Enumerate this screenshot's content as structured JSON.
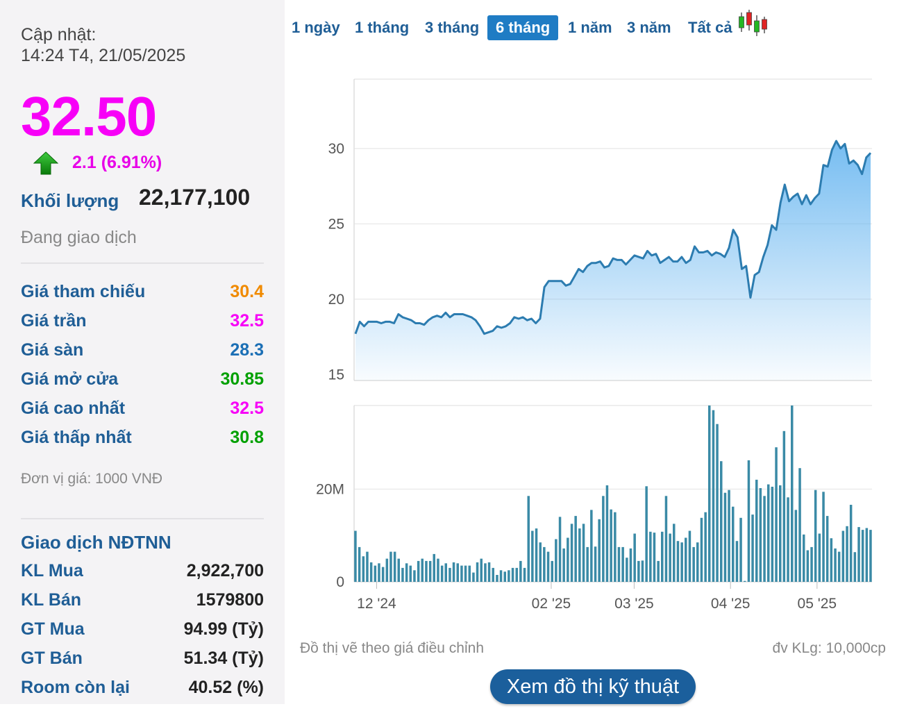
{
  "quote": {
    "update_label": "Cập nhật:",
    "update_time": "14:24 T4, 21/05/2025",
    "price": "32.50",
    "change": "2.1 (6.91%)",
    "volume_label": "Khối lượng",
    "volume_value": "22,177,100",
    "status": "Đang giao dịch"
  },
  "price_rows": [
    {
      "label": "Giá tham chiếu",
      "value": "30.4",
      "color": "#f08a00"
    },
    {
      "label": "Giá trần",
      "value": "32.5",
      "color": "#f700f7"
    },
    {
      "label": "Giá sàn",
      "value": "28.3",
      "color": "#1b6fb5"
    },
    {
      "label": "Giá mở cửa",
      "value": "30.85",
      "color": "#00a000"
    },
    {
      "label": "Giá cao nhất",
      "value": "32.5",
      "color": "#f700f7"
    },
    {
      "label": "Giá thấp nhất",
      "value": "30.8",
      "color": "#00a000"
    }
  ],
  "unit_note": "Đơn vị giá: 1000 VNĐ",
  "foreign": {
    "title": "Giao dịch NĐTNN",
    "rows": [
      {
        "label": "KL Mua",
        "value": "2,922,700"
      },
      {
        "label": "KL Bán",
        "value": "1579800"
      },
      {
        "label": "GT Mua",
        "value": "94.99 (Tỷ)"
      },
      {
        "label": "GT Bán",
        "value": "51.34 (Tỷ)"
      },
      {
        "label": "Room còn lại",
        "value": "40.52 (%)"
      }
    ]
  },
  "tabs": [
    {
      "label": "1 ngày",
      "active": false
    },
    {
      "label": "1 tháng",
      "active": false
    },
    {
      "label": "3 tháng",
      "active": false
    },
    {
      "label": "6 tháng",
      "active": true
    },
    {
      "label": "1 năm",
      "active": false
    },
    {
      "label": "3 năm",
      "active": false
    },
    {
      "label": "Tất cả",
      "active": false
    }
  ],
  "candle_icon": "candlestick-chart-icon",
  "chart_data": [
    {
      "type": "area",
      "yticks": [
        15,
        20,
        25,
        30
      ],
      "ylim": [
        14.6,
        34.6
      ],
      "x_ticks": [
        "12 '24",
        "02 '25",
        "03 '25",
        "04 '25",
        "05 '25"
      ],
      "values": [
        17.7,
        18.5,
        18.2,
        18.5,
        18.5,
        18.5,
        18.4,
        18.5,
        18.5,
        18.4,
        19.0,
        18.8,
        18.7,
        18.6,
        18.4,
        18.4,
        18.3,
        18.6,
        18.8,
        18.9,
        18.8,
        19.1,
        18.8,
        19.0,
        19.0,
        19.0,
        18.9,
        18.8,
        18.6,
        18.2,
        17.7,
        17.8,
        17.9,
        18.2,
        18.1,
        18.2,
        18.4,
        18.8,
        18.7,
        18.8,
        18.6,
        18.7,
        18.4,
        18.7,
        20.8,
        21.2,
        21.2,
        21.2,
        21.2,
        20.9,
        21.0,
        21.5,
        22.0,
        21.8,
        22.2,
        22.4,
        22.4,
        22.5,
        22.1,
        22.2,
        22.7,
        22.6,
        22.6,
        22.3,
        22.6,
        22.9,
        22.8,
        22.7,
        23.2,
        22.9,
        23.0,
        22.4,
        22.6,
        22.8,
        22.5,
        22.5,
        22.8,
        22.4,
        22.6,
        23.5,
        23.1,
        23.1,
        23.2,
        22.9,
        23.1,
        23.0,
        22.8,
        23.4,
        24.6,
        24.1,
        22.0,
        22.2,
        20.1,
        21.6,
        21.8,
        22.8,
        23.6,
        24.9,
        24.6,
        26.4,
        27.6,
        26.5,
        26.8,
        27.0,
        26.3,
        26.9,
        26.3,
        26.7,
        27.0,
        28.9,
        28.8,
        29.9,
        30.5,
        30.0,
        30.3,
        29.0,
        29.2,
        28.9,
        28.3,
        29.4,
        29.7
      ]
    },
    {
      "type": "bar",
      "yticks": [
        0,
        20
      ],
      "ytick_labels": [
        "0",
        "20M"
      ],
      "ylim": [
        0,
        38
      ],
      "unit_note": "đv KLg: 10,000cp",
      "values": [
        11,
        7.5,
        5.5,
        6.5,
        4.2,
        3.5,
        4,
        3.2,
        5,
        6.5,
        6.5,
        5,
        3,
        4,
        3.5,
        2.5,
        4.5,
        5,
        4.5,
        4.5,
        6,
        5,
        3.5,
        4,
        3,
        4.2,
        4,
        3.5,
        3.5,
        3.5,
        2,
        4.2,
        5,
        4,
        4.2,
        3,
        1.5,
        2.5,
        2.2,
        2.5,
        3,
        3,
        4.5,
        3,
        18.5,
        11,
        11.5,
        8.5,
        7.5,
        6.5,
        4.5,
        9.2,
        14,
        7.2,
        9.5,
        12.5,
        14.2,
        11.5,
        12.5,
        7.5,
        15.5,
        7.6,
        13.5,
        18.5,
        20.8,
        15.6,
        15,
        7.5,
        7.5,
        5.2,
        7.2,
        10.4,
        4.5,
        4.6,
        20.6,
        10.8,
        10.6,
        4.5,
        10.8,
        18.5,
        10.4,
        12.5,
        8.8,
        8.5,
        9.5,
        11,
        7.5,
        8.5,
        13.8,
        15,
        38,
        37,
        34,
        26,
        19.2,
        19.8,
        16.2,
        8.8,
        13.8,
        0.2,
        26.2,
        14.5,
        22,
        20.2,
        18.5,
        21,
        20.5,
        29,
        20.8,
        32.5,
        18.2,
        38,
        15.5,
        24.5,
        10.2,
        6.8,
        7.5,
        19.8,
        10.4,
        19.4,
        14.2,
        9.4,
        7.2,
        6.5,
        11,
        12,
        16.6,
        6.4,
        11.8,
        11.2,
        11.6,
        11.2
      ]
    }
  ],
  "chart_notes": {
    "left": "Đồ thị vẽ theo giá điều chỉnh",
    "right": "đv KLg: 10,000cp"
  },
  "tech_button": "Xem đồ thị kỹ thuật"
}
